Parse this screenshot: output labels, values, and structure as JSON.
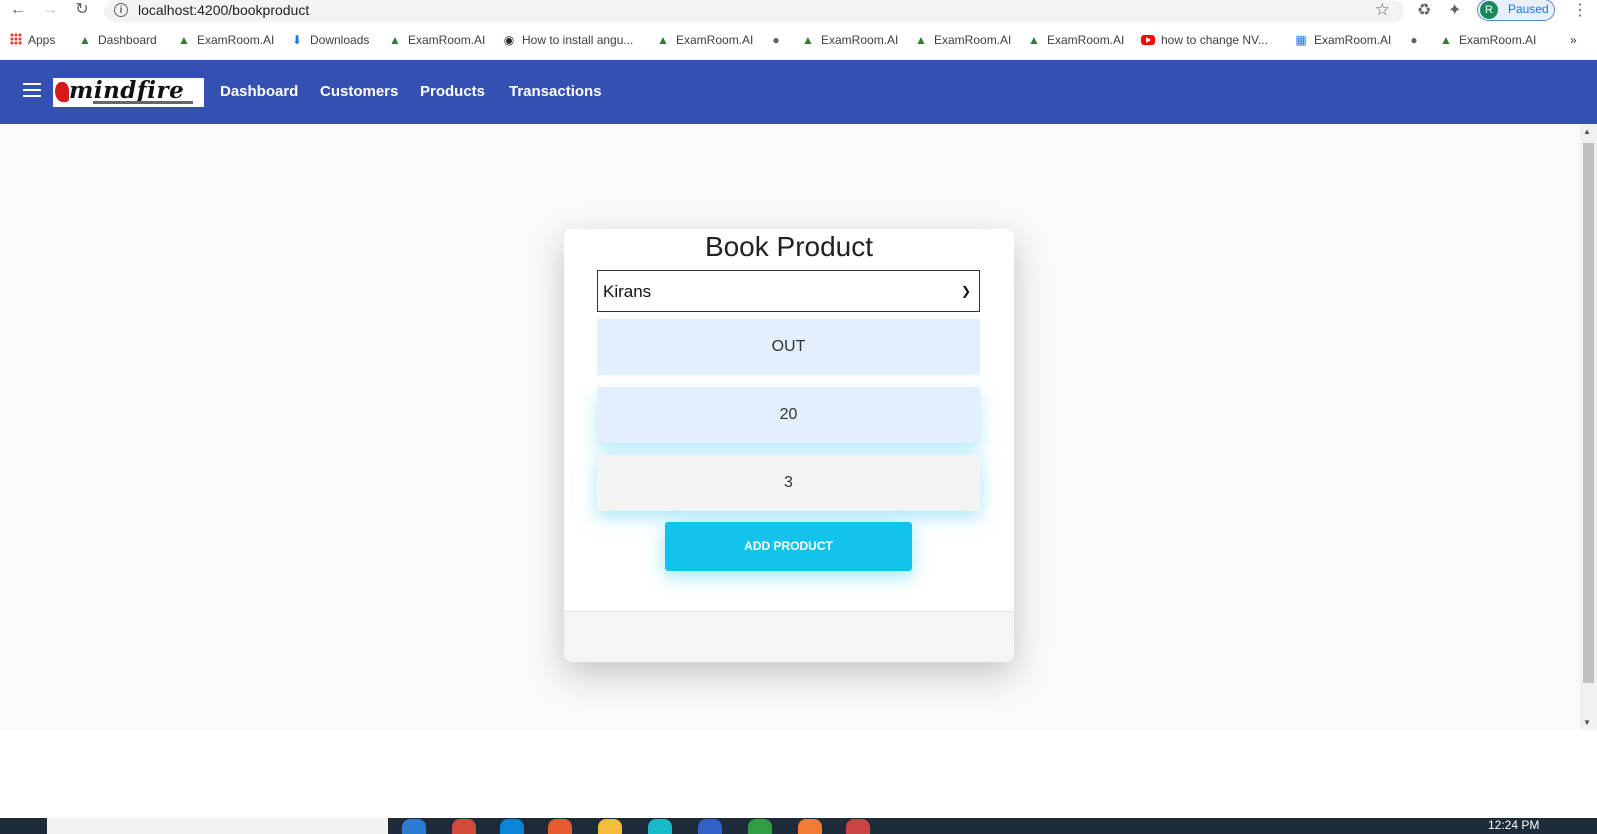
{
  "browser": {
    "url": "localhost:4200/bookproduct",
    "profile_initial": "R",
    "profile_status": "Paused",
    "bookmarks": [
      {
        "label": "Apps",
        "icon": "apps-grid-icon"
      },
      {
        "label": "Dashboard",
        "icon": "examroom-icon"
      },
      {
        "label": "ExamRoom.AI",
        "icon": "examroom-icon"
      },
      {
        "label": "Downloads",
        "icon": "download-icon"
      },
      {
        "label": "ExamRoom.AI",
        "icon": "examroom-icon"
      },
      {
        "label": "How to install angu...",
        "icon": "github-icon"
      },
      {
        "label": "ExamRoom.AI",
        "icon": "examroom-icon"
      },
      {
        "label": "",
        "icon": "globe-icon"
      },
      {
        "label": "ExamRoom.AI",
        "icon": "examroom-icon"
      },
      {
        "label": "ExamRoom.AI",
        "icon": "examroom-icon"
      },
      {
        "label": "ExamRoom.AI",
        "icon": "examroom-icon"
      },
      {
        "label": "how to change NV...",
        "icon": "youtube-icon"
      },
      {
        "label": "ExamRoom.AI",
        "icon": "examroom-icon"
      },
      {
        "label": "",
        "icon": "globe-icon"
      },
      {
        "label": "ExamRoom.AI",
        "icon": "examroom-icon"
      }
    ],
    "overflow": "»"
  },
  "navbar": {
    "logo_text": "mindfire",
    "links": [
      "Dashboard",
      "Customers",
      "Products",
      "Transactions"
    ],
    "color": "#3451b2"
  },
  "card": {
    "title": "Book Product",
    "selected_customer": "Kirans",
    "transaction_type": "OUT",
    "quantity": "20",
    "third_value": "3",
    "submit_label": "ADD PRODUCT",
    "button_color": "#14c3eb"
  },
  "taskbar": {
    "time": "12:24 PM"
  }
}
